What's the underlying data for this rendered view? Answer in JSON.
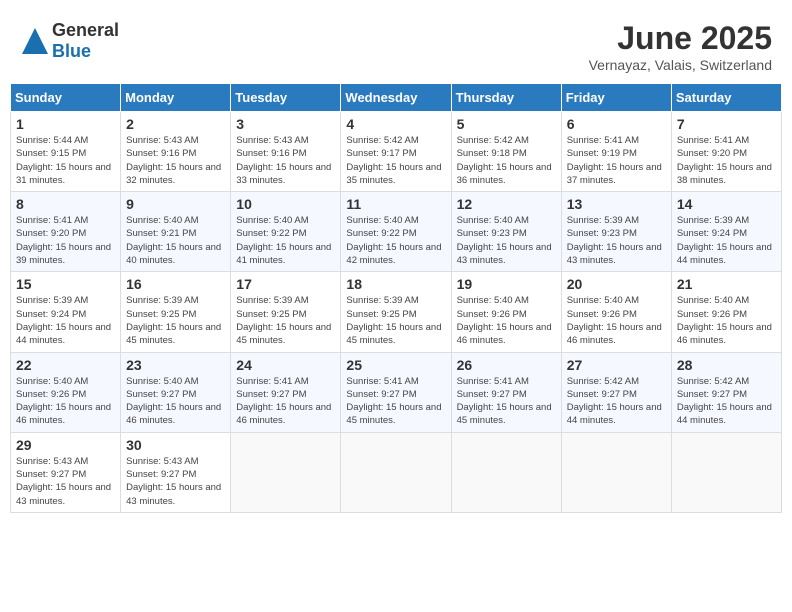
{
  "header": {
    "logo_general": "General",
    "logo_blue": "Blue",
    "month": "June 2025",
    "location": "Vernayaz, Valais, Switzerland"
  },
  "weekdays": [
    "Sunday",
    "Monday",
    "Tuesday",
    "Wednesday",
    "Thursday",
    "Friday",
    "Saturday"
  ],
  "days": [
    {
      "date": 1,
      "col": 0,
      "sunrise": "5:44 AM",
      "sunset": "9:15 PM",
      "daylight": "15 hours and 31 minutes."
    },
    {
      "date": 2,
      "col": 1,
      "sunrise": "5:43 AM",
      "sunset": "9:16 PM",
      "daylight": "15 hours and 32 minutes."
    },
    {
      "date": 3,
      "col": 2,
      "sunrise": "5:43 AM",
      "sunset": "9:16 PM",
      "daylight": "15 hours and 33 minutes."
    },
    {
      "date": 4,
      "col": 3,
      "sunrise": "5:42 AM",
      "sunset": "9:17 PM",
      "daylight": "15 hours and 35 minutes."
    },
    {
      "date": 5,
      "col": 4,
      "sunrise": "5:42 AM",
      "sunset": "9:18 PM",
      "daylight": "15 hours and 36 minutes."
    },
    {
      "date": 6,
      "col": 5,
      "sunrise": "5:41 AM",
      "sunset": "9:19 PM",
      "daylight": "15 hours and 37 minutes."
    },
    {
      "date": 7,
      "col": 6,
      "sunrise": "5:41 AM",
      "sunset": "9:20 PM",
      "daylight": "15 hours and 38 minutes."
    },
    {
      "date": 8,
      "col": 0,
      "sunrise": "5:41 AM",
      "sunset": "9:20 PM",
      "daylight": "15 hours and 39 minutes."
    },
    {
      "date": 9,
      "col": 1,
      "sunrise": "5:40 AM",
      "sunset": "9:21 PM",
      "daylight": "15 hours and 40 minutes."
    },
    {
      "date": 10,
      "col": 2,
      "sunrise": "5:40 AM",
      "sunset": "9:22 PM",
      "daylight": "15 hours and 41 minutes."
    },
    {
      "date": 11,
      "col": 3,
      "sunrise": "5:40 AM",
      "sunset": "9:22 PM",
      "daylight": "15 hours and 42 minutes."
    },
    {
      "date": 12,
      "col": 4,
      "sunrise": "5:40 AM",
      "sunset": "9:23 PM",
      "daylight": "15 hours and 43 minutes."
    },
    {
      "date": 13,
      "col": 5,
      "sunrise": "5:39 AM",
      "sunset": "9:23 PM",
      "daylight": "15 hours and 43 minutes."
    },
    {
      "date": 14,
      "col": 6,
      "sunrise": "5:39 AM",
      "sunset": "9:24 PM",
      "daylight": "15 hours and 44 minutes."
    },
    {
      "date": 15,
      "col": 0,
      "sunrise": "5:39 AM",
      "sunset": "9:24 PM",
      "daylight": "15 hours and 44 minutes."
    },
    {
      "date": 16,
      "col": 1,
      "sunrise": "5:39 AM",
      "sunset": "9:25 PM",
      "daylight": "15 hours and 45 minutes."
    },
    {
      "date": 17,
      "col": 2,
      "sunrise": "5:39 AM",
      "sunset": "9:25 PM",
      "daylight": "15 hours and 45 minutes."
    },
    {
      "date": 18,
      "col": 3,
      "sunrise": "5:39 AM",
      "sunset": "9:25 PM",
      "daylight": "15 hours and 45 minutes."
    },
    {
      "date": 19,
      "col": 4,
      "sunrise": "5:40 AM",
      "sunset": "9:26 PM",
      "daylight": "15 hours and 46 minutes."
    },
    {
      "date": 20,
      "col": 5,
      "sunrise": "5:40 AM",
      "sunset": "9:26 PM",
      "daylight": "15 hours and 46 minutes."
    },
    {
      "date": 21,
      "col": 6,
      "sunrise": "5:40 AM",
      "sunset": "9:26 PM",
      "daylight": "15 hours and 46 minutes."
    },
    {
      "date": 22,
      "col": 0,
      "sunrise": "5:40 AM",
      "sunset": "9:26 PM",
      "daylight": "15 hours and 46 minutes."
    },
    {
      "date": 23,
      "col": 1,
      "sunrise": "5:40 AM",
      "sunset": "9:27 PM",
      "daylight": "15 hours and 46 minutes."
    },
    {
      "date": 24,
      "col": 2,
      "sunrise": "5:41 AM",
      "sunset": "9:27 PM",
      "daylight": "15 hours and 46 minutes."
    },
    {
      "date": 25,
      "col": 3,
      "sunrise": "5:41 AM",
      "sunset": "9:27 PM",
      "daylight": "15 hours and 45 minutes."
    },
    {
      "date": 26,
      "col": 4,
      "sunrise": "5:41 AM",
      "sunset": "9:27 PM",
      "daylight": "15 hours and 45 minutes."
    },
    {
      "date": 27,
      "col": 5,
      "sunrise": "5:42 AM",
      "sunset": "9:27 PM",
      "daylight": "15 hours and 44 minutes."
    },
    {
      "date": 28,
      "col": 6,
      "sunrise": "5:42 AM",
      "sunset": "9:27 PM",
      "daylight": "15 hours and 44 minutes."
    },
    {
      "date": 29,
      "col": 0,
      "sunrise": "5:43 AM",
      "sunset": "9:27 PM",
      "daylight": "15 hours and 43 minutes."
    },
    {
      "date": 30,
      "col": 1,
      "sunrise": "5:43 AM",
      "sunset": "9:27 PM",
      "daylight": "15 hours and 43 minutes."
    }
  ]
}
